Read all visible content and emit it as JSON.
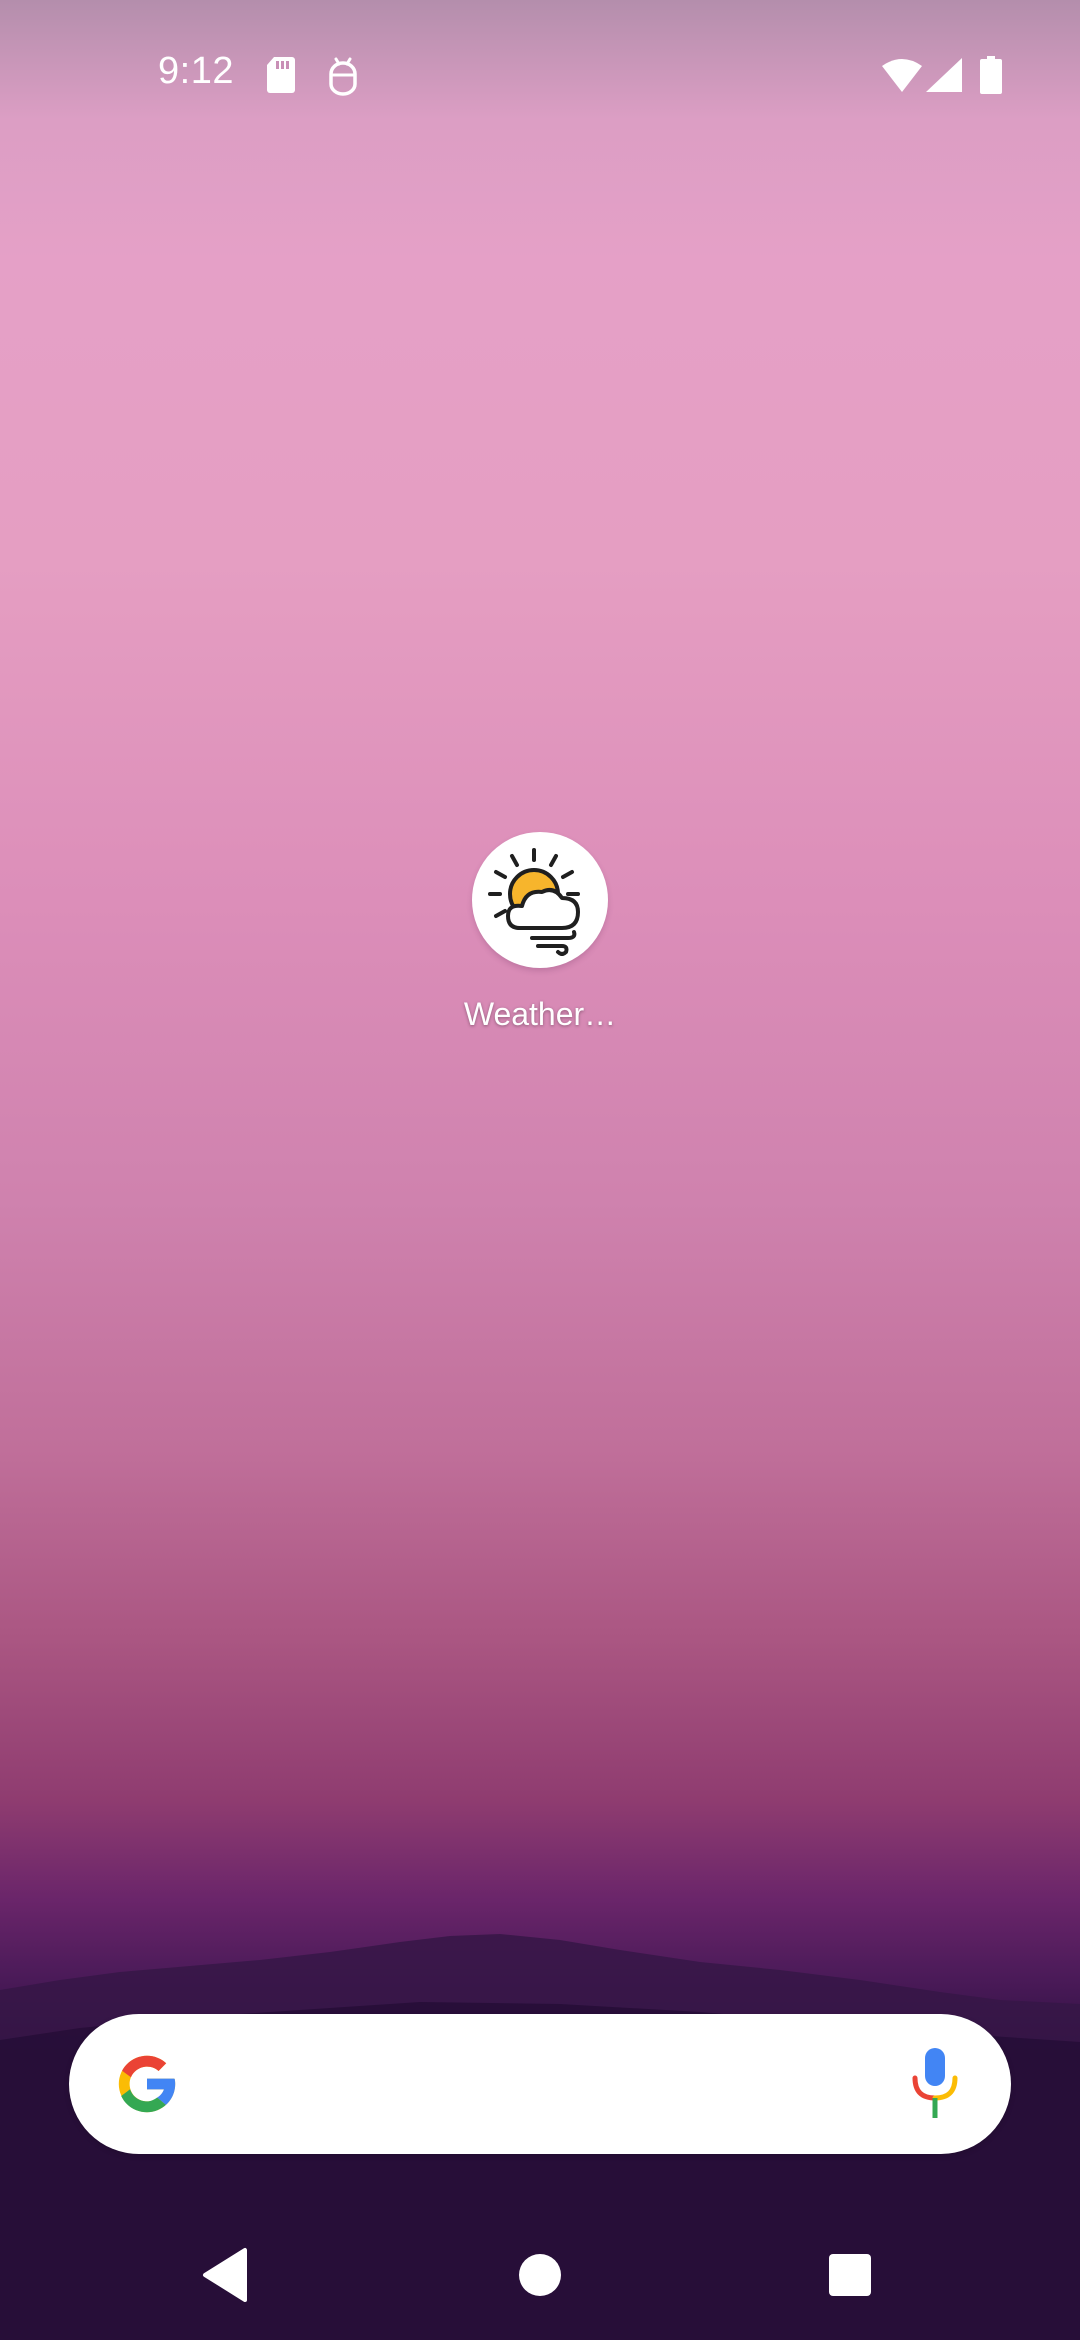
{
  "status_bar": {
    "time": "9:12",
    "icons": [
      "sd-card-icon",
      "debug-icon",
      "wifi-icon",
      "signal-icon",
      "battery-icon"
    ]
  },
  "home": {
    "apps": [
      {
        "label": "Weather…",
        "icon": "weather-partly-cloudy-windy-icon"
      }
    ]
  },
  "search_bar": {
    "logo": "google-g-logo",
    "voice_icon": "mic-icon"
  },
  "nav_bar": {
    "buttons": [
      "back-icon",
      "home-icon",
      "recents-icon"
    ]
  },
  "colors": {
    "google_blue": "#4285F4",
    "google_red": "#EA4335",
    "google_yellow": "#FBBC05",
    "google_green": "#34A853",
    "sun_yellow": "#F7B52C"
  }
}
